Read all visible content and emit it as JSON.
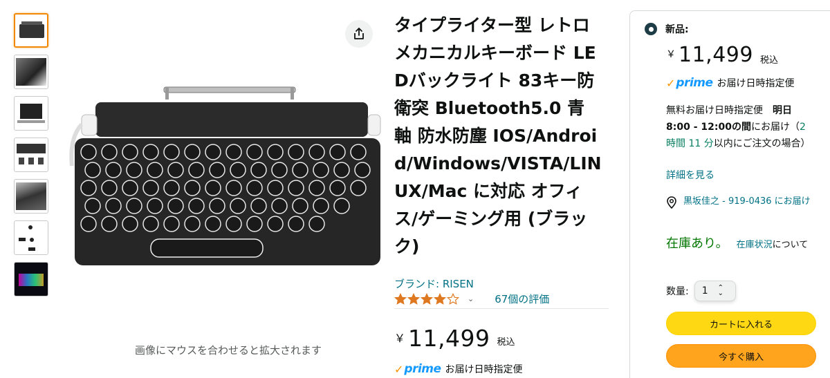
{
  "gallery": {
    "hover_hint": "画像にマウスを合わせると拡大されます",
    "thumbnail_count": 7,
    "active_thumbnail": 1
  },
  "product": {
    "title": "タイプライター型 レトロ メカニカルキーボード LEDバックライト 83キー防衛突 Bluetooth5.0 青軸 防水防塵 IOS/Android/Windows/VISTA/LINUX/Mac に対応 オフィス/ゲーミング用 (ブラック)",
    "brand": "ブランド: RISEN",
    "rating_stars": 4,
    "reviews": "67個の評価",
    "price_yen": "￥",
    "price": "11,499",
    "tax": "税込",
    "prime_word": "prime",
    "prime_text": "お届け日時指定便"
  },
  "buybox": {
    "condition": "新品:",
    "price_yen": "￥",
    "price": "11,499",
    "tax": "税込",
    "prime_text": "お届け日時指定便",
    "delivery_prefix": "無料お届け日時指定便",
    "delivery_date": "明日 8:00 - 12:00の間",
    "delivery_mid": "にお届け（",
    "delivery_countdown": "2 時間 11 分",
    "delivery_suffix": "以内にご注文の場合）",
    "details_link": "詳細を見る",
    "location": "黒坂佳之 - 919-0436 にお届け",
    "stock_status": "在庫あり。",
    "stock_link": "在庫状況",
    "stock_suffix": "について",
    "qty_label": "数量:",
    "qty_value": "1",
    "add_to_cart": "カートに入れる",
    "buy_now": "今すぐ購入"
  },
  "colors": {
    "link": "#007185",
    "prime": "#1399ff",
    "cart_button": "#ffd814",
    "buy_button": "#ffa41c",
    "in_stock": "#007600",
    "star": "#de7921"
  }
}
